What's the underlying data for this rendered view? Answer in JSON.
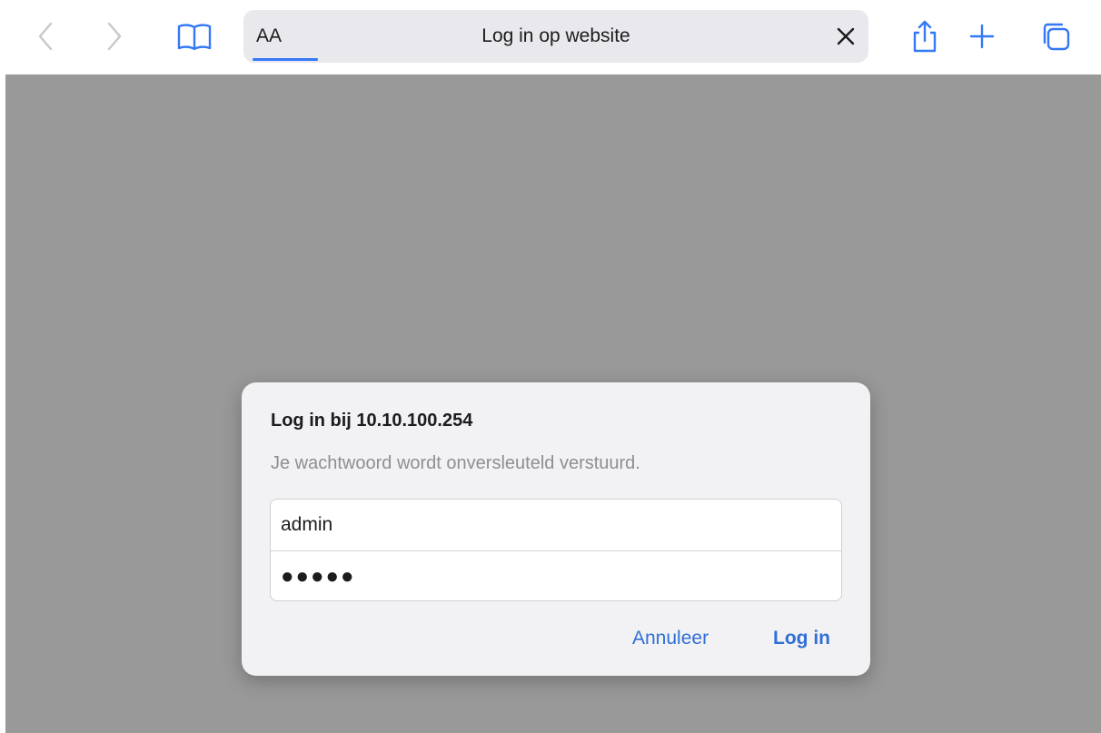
{
  "toolbar": {
    "reader_label": "AA",
    "page_title": "Log in op website"
  },
  "dialog": {
    "title": "Log in bij 10.10.100.254",
    "message": "Je wachtwoord wordt onversleuteld verstuurd.",
    "username_value": "admin",
    "password_value": "●●●●●",
    "cancel_label": "Annuleer",
    "login_label": "Log in"
  },
  "colors": {
    "accent": "#3478f6",
    "content_overlay": "#999999",
    "dialog_bg": "#f2f2f4"
  }
}
